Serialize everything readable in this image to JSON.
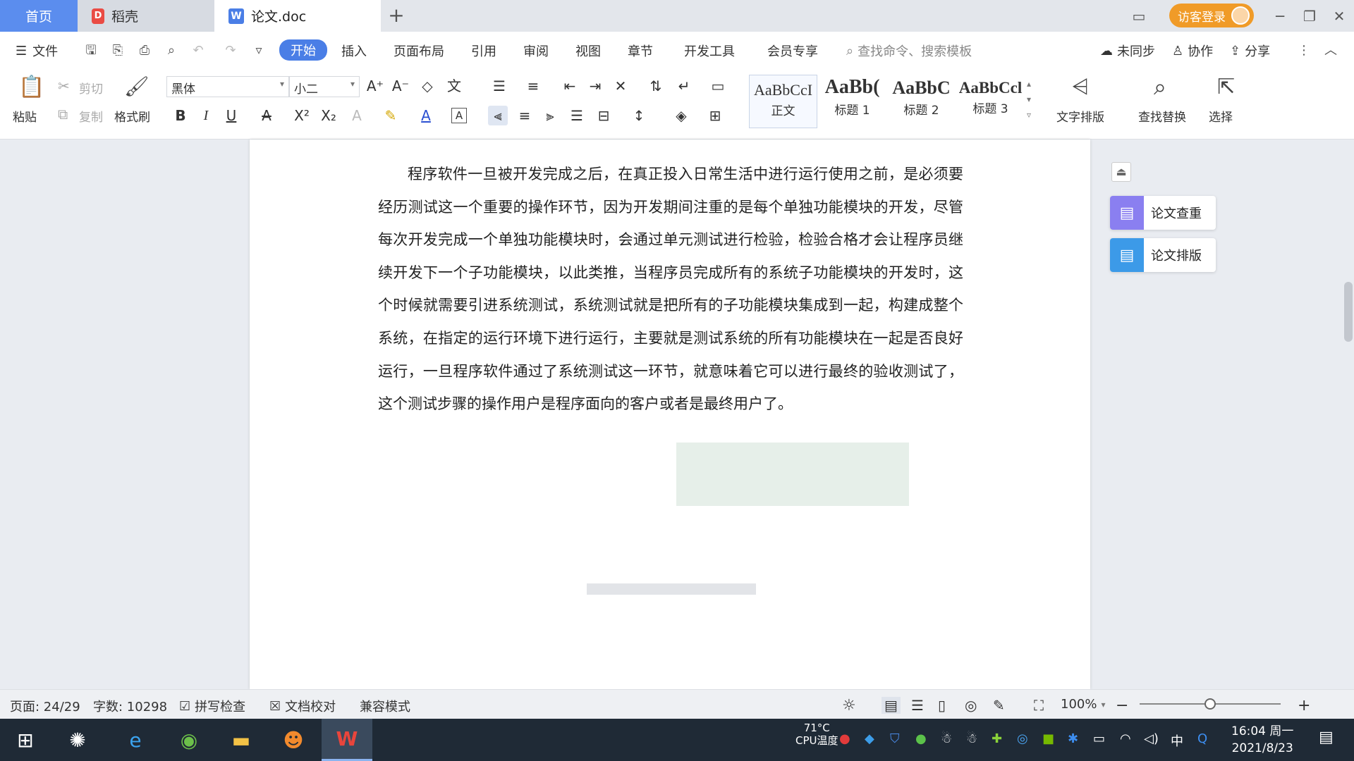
{
  "tabs": {
    "home": "首页",
    "daoke": "稻壳",
    "doc": "论文.doc",
    "new": "+"
  },
  "titlebar": {
    "login": "访客登录"
  },
  "menubar": {
    "file": "文件",
    "items": [
      "开始",
      "插入",
      "页面布局",
      "引用",
      "审阅",
      "视图",
      "章节",
      "开发工具",
      "会员专享"
    ],
    "search_placeholder": "查找命令、搜索模板",
    "sync": "未同步",
    "collab": "协作",
    "share": "分享"
  },
  "ribbon": {
    "paste": "粘贴",
    "cut": "剪切",
    "copy": "复制",
    "format_painter": "格式刷",
    "font_name": "黑体",
    "font_size": "小二",
    "styles": [
      {
        "sample": "AaBbCcI",
        "name": "正文"
      },
      {
        "sample": "AaBb(",
        "name": "标题 1"
      },
      {
        "sample": "AaBbC",
        "name": "标题 2"
      },
      {
        "sample": "AaBbCcl",
        "name": "标题 3"
      }
    ],
    "text_layout": "文字排版",
    "find_replace": "查找替换",
    "select": "选择"
  },
  "document": {
    "paragraph": "程序软件一旦被开发完成之后，在真正投入日常生活中进行运行使用之前，是必须要经历测试这一个重要的操作环节，因为开发期间注重的是每个单独功能模块的开发，尽管每次开发完成一个单独功能模块时，会通过单元测试进行检验，检验合格才会让程序员继续开发下一个子功能模块，以此类推，当程序员完成所有的系统子功能模块的开发时，这个时候就需要引进系统测试，系统测试就是把所有的子功能模块集成到一起，构建成整个系统，在指定的运行环境下进行运行，主要就是测试系统的所有功能模块在一起是否良好运行，一旦程序软件通过了系统测试这一环节，就意味着它可以进行最终的验收测试了，这个测试步骤的操作用户是程序面向的客户或者是最终用户了。"
  },
  "side_panel": {
    "check": "论文查重",
    "layout": "论文排版"
  },
  "statusbar": {
    "page": "页面: 24/29",
    "words": "字数: 10298",
    "spell": "拼写检查",
    "proof": "文档校对",
    "compat": "兼容模式",
    "zoom": "100%"
  },
  "taskbar": {
    "cpu_temp": "71°C",
    "cpu_label": "CPU温度",
    "ime": "中",
    "time": "16:04 周一",
    "date": "2021/8/23"
  },
  "colors": {
    "accent": "#4a7ee6",
    "home_tab": "#5b8dee",
    "login": "#f09b28",
    "taskbar": "#1f2a36"
  }
}
